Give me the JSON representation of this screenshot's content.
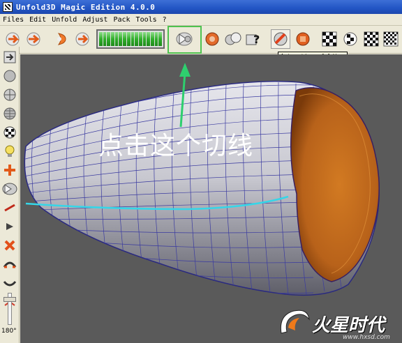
{
  "window": {
    "title": "Unfold3D Magic Edition 4.0.0"
  },
  "menu": [
    "Files",
    "Edit",
    "Unfold",
    "Adjust",
    "Pack",
    "Tools",
    "?"
  ],
  "toolbar": {
    "buttons": [
      "open-icon",
      "save-icon",
      "unfold-step-icon",
      "forward-icon",
      "cut-edges-icon",
      "weld-icon",
      "select-icon",
      "help-query-icon",
      "automatic-unfolding-icon",
      "stop-icon",
      "checker-a-icon",
      "checker-b-icon",
      "checker-c-icon",
      "checker-d-icon"
    ],
    "progress_value": 1.0,
    "tooltip": "Automatic unfolding"
  },
  "left_toolbar": {
    "buttons": [
      "import-icon",
      "sphere-icon",
      "globe-icon",
      "globe-grid-icon",
      "checker-sphere-icon",
      "light-bulb-icon",
      "transform-icon",
      "cut-line-icon",
      "pen-line-icon",
      "pointer-icon",
      "delete-icon",
      "fold-icon",
      "unfold-arc-icon",
      "scissors-icon"
    ],
    "angle_label": "180°"
  },
  "viewport": {
    "annotation": "点击这个切线",
    "colors": {
      "background": "#5a5a5a",
      "mesh_surface": "#c8c8d0",
      "wireframe": "#3a3aa0",
      "cut_line": "#35d6e8",
      "interior": "#c0701e",
      "arrow": "#2ecf6e"
    }
  },
  "watermark": {
    "logo_text": "火星时代",
    "url": "www.hxsd.com"
  }
}
